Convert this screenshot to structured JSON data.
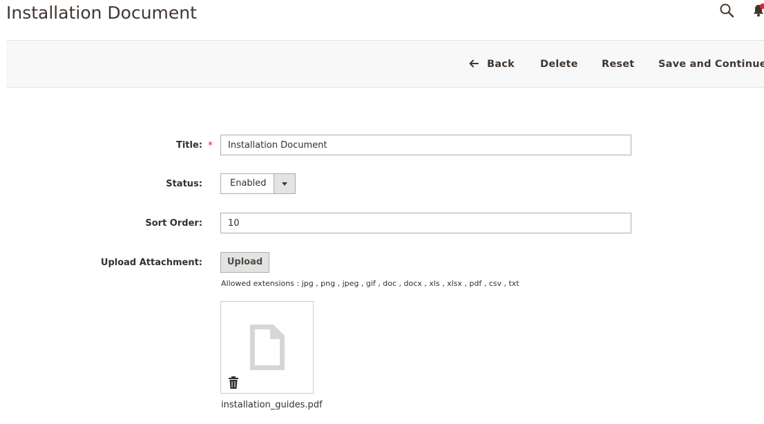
{
  "header": {
    "title": "Installation Document",
    "search_icon": "search-icon",
    "notifications_icon": "bell-icon"
  },
  "actions": {
    "back_label": "Back",
    "back_icon": "arrow-left-icon",
    "delete_label": "Delete",
    "reset_label": "Reset",
    "save_continue_label": "Save and Continue Edit"
  },
  "form": {
    "title": {
      "label": "Title:",
      "required": "*",
      "value": "Installation Document"
    },
    "status": {
      "label": "Status:",
      "selected": "Enabled"
    },
    "sort_order": {
      "label": "Sort Order:",
      "value": "10"
    },
    "upload": {
      "label": "Upload Attachment:",
      "button_label": "Upload",
      "allowed_extensions": "Allowed extensions : jpg , png , jpeg , gif , doc , docx , xls , xlsx , pdf , csv , txt",
      "file_icon": "document-icon",
      "delete_icon": "trash-icon",
      "file_name": "installation_guides.pdf"
    }
  },
  "colors": {
    "title_text": "#41362f",
    "action_bar_bg": "#f8f8f8",
    "required_star": "#e22626",
    "notification_badge": "#e22626",
    "file_icon_fill": "#d6d6d6"
  }
}
